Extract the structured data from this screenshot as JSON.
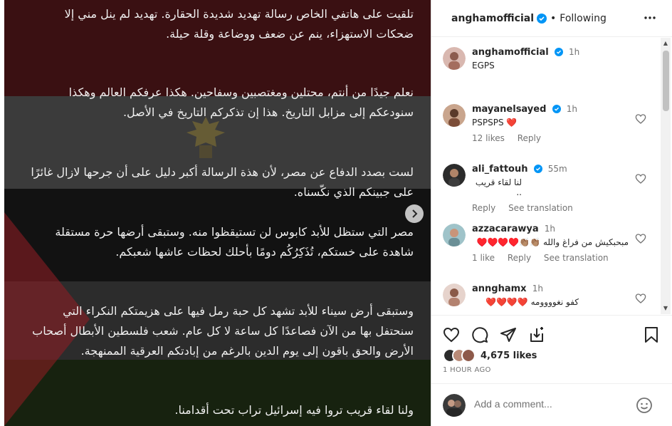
{
  "post": {
    "paragraphs": [
      "تلقيت على هاتفي الخاص رسالة تهديد شديدة الحقارة. تهديد لم ينل مني إلا ضحكات الاستهزاء، ينم عن ضعف ووضاعة وقلة حيلة.",
      "نعلم جيدًا من أنتم، محتلين ومغتصبين وسفاحين. هكذا عرفكم العالم وهكذا سنودعكم إلى مزابل التاريخ. هذا إن تذكركم التاريخ في الأصل.",
      "لست بصدد الدفاع عن مصر، لأن هذة الرسالة أكبر دليل على أن جرحها لازال غائرًا على جبينكم الذي نكّسناه.",
      "مصر التي ستظل للأبد كابوس لن تستيقظوا منه. وستبقى أرضها حرة مستقلة شاهدة على خستكم، تُذَكِرُكُم دومًا بأحلك لحظات عاشها شعبكم.",
      "وستبقى أرض سيناء للأبد تشهد كل حبة رمل فيها على هزيمتكم النكراء التي سنحتفل بها من الآن فصاعدًا كل ساعة لا كل عام. شعب فلسطين الأبطال أصحاب الأرض والحق باقون إلى يوم الدين بالرغم من إبادتكم العرقية الممنهجة.",
      "ولنا لقاء قريب تروا فيه إسرائيل تراب تحت أقدامنا."
    ]
  },
  "header": {
    "username": "anghamofficial",
    "separator": "•",
    "follow_status": "Following"
  },
  "comments": [
    {
      "username": "anghamofficial",
      "verified": true,
      "time": "1h",
      "text": "EGPS",
      "rtl": false,
      "likes": "",
      "reply": "",
      "translate": "",
      "has_heart": false
    },
    {
      "username": "mayanelsayed",
      "verified": true,
      "time": "1h",
      "text": "PSPSPS ❤️",
      "rtl": false,
      "likes": "12 likes",
      "reply": "Reply",
      "translate": "",
      "has_heart": true
    },
    {
      "username": "ali_fattouh",
      "verified": true,
      "time": "55m",
      "text": "لنا لقاء قريب ..",
      "rtl": true,
      "likes": "",
      "reply": "Reply",
      "translate": "See translation",
      "has_heart": true
    },
    {
      "username": "azzacarawya",
      "verified": false,
      "time": "1h",
      "text": "مبحبكيش من فراغ والله 👏🏽👏🏽♥️♥️♥️♥️",
      "rtl": true,
      "likes": "1 like",
      "reply": "Reply",
      "translate": "See translation",
      "has_heart": true
    },
    {
      "username": "annghamx",
      "verified": false,
      "time": "1h",
      "text": "كفو نغوووومه ❤️❤️❤️❤️",
      "rtl": true,
      "likes": "",
      "reply": "",
      "translate": "",
      "has_heart": true
    }
  ],
  "likes": {
    "count": "4,675 likes",
    "time_ago": "1 HOUR AGO"
  },
  "add_comment": {
    "placeholder": "Add a comment..."
  },
  "icons": {
    "like": "heart-icon",
    "comment": "comment-icon",
    "share": "send-icon",
    "save": "bookmark-icon",
    "repost": "repost-icon",
    "emoji": "emoji-icon",
    "more": "more-options-icon",
    "next": "chevron-right-icon",
    "verified": "verified-badge-icon"
  },
  "colors": {
    "verified_blue": "#0095f6",
    "muted_text": "#737373",
    "heart_red": "#ed4956"
  }
}
